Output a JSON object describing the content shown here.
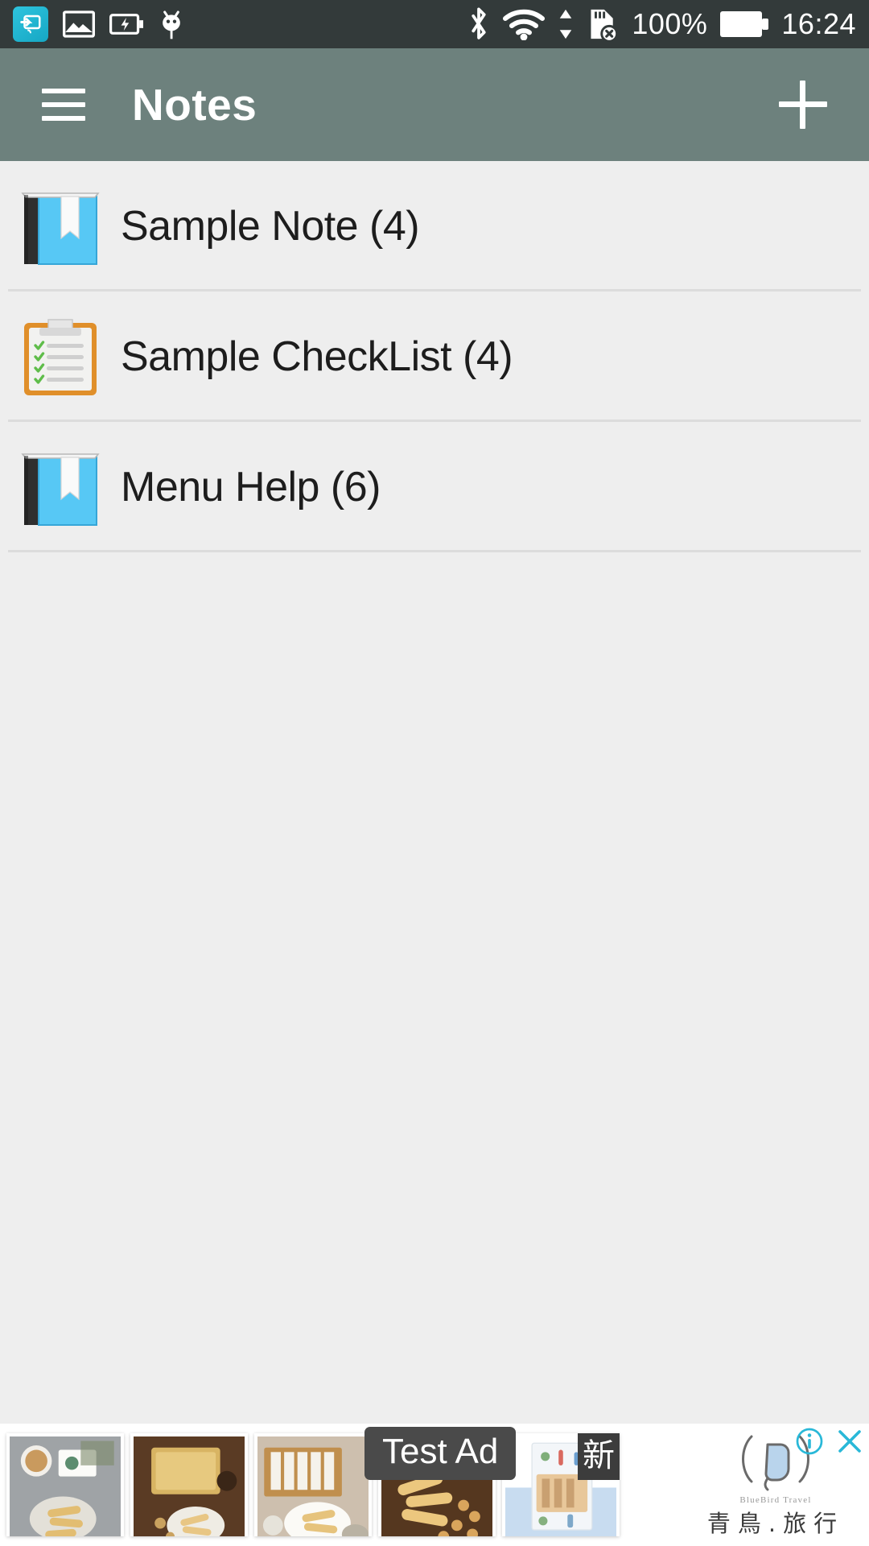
{
  "status_bar": {
    "background": "#333a3a",
    "left_icons": [
      {
        "name": "screen-cast-icon",
        "label": "cast"
      },
      {
        "name": "image-icon",
        "label": "screenshot"
      },
      {
        "name": "charging-battery-icon",
        "label": "charging"
      },
      {
        "name": "android-debug-icon",
        "label": "usb-debugging"
      }
    ],
    "right_icons": [
      {
        "name": "bluetooth-icon",
        "label": "bluetooth"
      },
      {
        "name": "wifi-icon",
        "label": "wifi"
      },
      {
        "name": "data-transfer-icon",
        "label": "up-down-arrows"
      },
      {
        "name": "sd-card-removed-icon",
        "label": "sd-card-removed"
      }
    ],
    "battery_percent": "100%",
    "time": "16:24"
  },
  "app_bar": {
    "background": "#6d817d",
    "title": "Notes",
    "menu_icon": "hamburger-menu-icon",
    "add_icon": "plus-icon"
  },
  "notes": [
    {
      "title": "Sample Note (4)",
      "icon": "blue-book-icon",
      "count": 4
    },
    {
      "title": "Sample CheckList (4)",
      "icon": "orange-clipboard-icon",
      "count": 4
    },
    {
      "title": "Menu Help (6)",
      "icon": "blue-book-icon",
      "count": 6
    }
  ],
  "ad_banner": {
    "test_label": "Test Ad",
    "new_badge": "新",
    "brand_cn": "青鳥.旅行",
    "brand_en": "BlueBird Travel",
    "info_icon": "info-icon",
    "close_icon": "close-icon",
    "accent": "#29b8d8",
    "images": [
      {
        "name": "ad-image-1",
        "alt": "snack rolls on plate"
      },
      {
        "name": "ad-image-2",
        "alt": "gift box on wood"
      },
      {
        "name": "ad-image-3",
        "alt": "pastry box display"
      },
      {
        "name": "ad-image-4",
        "alt": "rolls with peanuts"
      },
      {
        "name": "ad-image-5",
        "alt": "travel brochure"
      }
    ]
  }
}
